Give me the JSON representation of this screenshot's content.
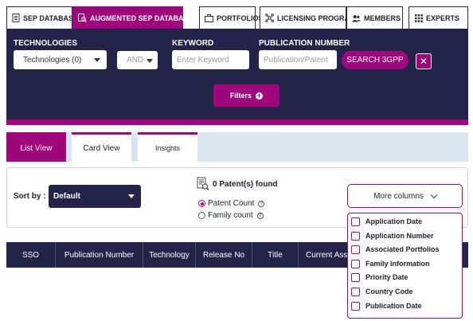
{
  "top_tabs": [
    {
      "label": "SEP DATABASE",
      "icon": "document-icon",
      "active": false
    },
    {
      "label": "AUGMENTED SEP DATABASE",
      "icon": "search-document-icon",
      "active": true
    },
    {
      "label": "PORTFOLIOS",
      "icon": "briefcase-icon",
      "active": false
    },
    {
      "label": "LICENSING PROGRAMS",
      "icon": "network-icon",
      "active": false
    },
    {
      "label": "MEMBERS",
      "icon": "users-icon",
      "active": false
    },
    {
      "label": "EXPERTS",
      "icon": "grid-icon",
      "active": false
    }
  ],
  "filters": {
    "technologies_label": "TECHNOLOGIES",
    "technologies_value": "Technologies (0)",
    "operator_value": "AND",
    "keyword_label": "KEYWORD",
    "keyword_placeholder": "Enter Keyword",
    "publication_label": "PUBLICATION NUMBER",
    "publication_placeholder": "Publication/Patent",
    "search_button": "SEARCH 3GPP",
    "close_symbol": "✕",
    "filters_button": "Filters",
    "plus_symbol": "+"
  },
  "view_tabs": [
    {
      "label": "List View",
      "active": true
    },
    {
      "label": "Card View",
      "active": false
    },
    {
      "label": "Insights",
      "active": false
    }
  ],
  "results": {
    "sort_label": "Sort by :",
    "sort_value": "Default",
    "found_text": "0 Patent(s) found",
    "radio_options": [
      {
        "label": "Patent Count",
        "selected": true
      },
      {
        "label": "Family count",
        "selected": false
      }
    ],
    "help_symbol": "?",
    "more_columns": "More columns"
  },
  "table_columns": [
    "SSO",
    "Publication Number",
    "Technology",
    "Release No",
    "Title",
    "Current Ass"
  ],
  "more_columns_options": [
    "Application Date",
    "Application Number",
    "Associated Portfolios",
    "Family Information",
    "Priority Date",
    "Country Code",
    "Publication Date"
  ],
  "colors": {
    "accent": "#a0077f",
    "navy": "#23244a",
    "tab_bar": "#d7e6f0"
  }
}
